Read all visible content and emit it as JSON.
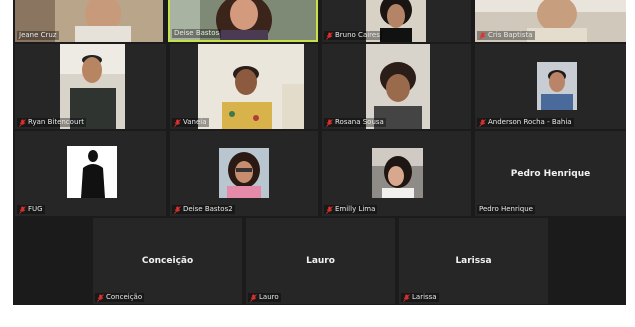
{
  "participants": [
    {
      "name": "Jeane Cruz",
      "muted": false
    },
    {
      "name": "Deise Bastos",
      "muted": false,
      "active_speaker": true
    },
    {
      "name": "Bruno Caires",
      "muted": true
    },
    {
      "name": "Cris Baptista",
      "muted": true
    },
    {
      "name": "Ryan Bitencourt",
      "muted": true
    },
    {
      "name": "Vaneia",
      "muted": true
    },
    {
      "name": "Rosana Sousa",
      "muted": true
    },
    {
      "name": "Anderson Rocha - Bahia",
      "muted": true
    },
    {
      "name": "FUG",
      "muted": true
    },
    {
      "name": "Deise Bastos2",
      "muted": true
    },
    {
      "name": "Emilly Lima",
      "muted": true
    },
    {
      "name": "Pedro Henrique",
      "muted": false,
      "no_video_label": "Pedro Henrique"
    },
    {
      "name": "Conceição",
      "muted": true,
      "no_video_label": "Conceição"
    },
    {
      "name": "Lauro",
      "muted": true,
      "no_video_label": "Lauro"
    },
    {
      "name": "Larissa",
      "muted": true,
      "no_video_label": "Larissa"
    }
  ],
  "colors": {
    "active_speaker_border": "#c8e04a",
    "muted_icon": "#e0312e",
    "tile_background": "#262626"
  },
  "icons": {
    "muted": "microphone-muted-icon"
  }
}
